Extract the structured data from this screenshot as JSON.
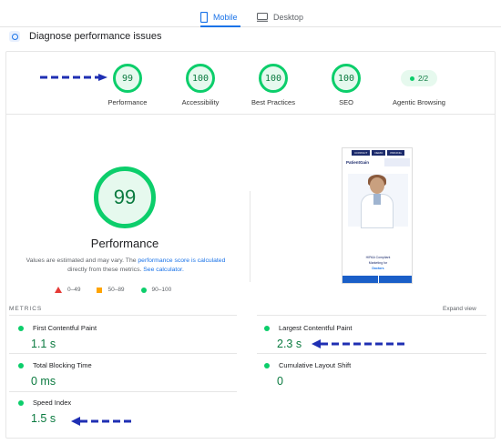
{
  "tabs": {
    "mobile": "Mobile",
    "desktop": "Desktop"
  },
  "diagnose_title": "Diagnose performance issues",
  "scores": [
    {
      "value": "99",
      "label": "Performance"
    },
    {
      "value": "100",
      "label": "Accessibility"
    },
    {
      "value": "100",
      "label": "Best Practices"
    },
    {
      "value": "100",
      "label": "SEO"
    }
  ],
  "agentic": {
    "value": "2/2",
    "label": "Agentic Browsing"
  },
  "main": {
    "score": "99",
    "title": "Performance",
    "note_pre": "Values are estimated and may vary. The ",
    "note_link1": "performance score is calculated",
    "note_mid": " directly from these metrics. ",
    "note_link2": "See calculator.",
    "legend": [
      "0–49",
      "50–89",
      "90–100"
    ]
  },
  "phone": {
    "menu": [
      "CONTACT",
      "DEMO",
      "PRICING"
    ],
    "logo": "PatientGain",
    "text_line1": "HIPAA Compliant",
    "text_line2": "Marketing for",
    "text_line3": "Doctors"
  },
  "metrics": {
    "header": "METRICS",
    "expand": "Expand view",
    "items": [
      {
        "name": "First Contentful Paint",
        "value": "1.1 s"
      },
      {
        "name": "Largest Contentful Paint",
        "value": "2.3 s"
      },
      {
        "name": "Total Blocking Time",
        "value": "0 ms"
      },
      {
        "name": "Cumulative Layout Shift",
        "value": "0"
      },
      {
        "name": "Speed Index",
        "value": "1.5 s"
      }
    ]
  },
  "colors": {
    "good": "#0cce6b",
    "good_text": "#0a7a3f",
    "accent": "#1a73e8",
    "arrow": "#1f2fb3"
  }
}
